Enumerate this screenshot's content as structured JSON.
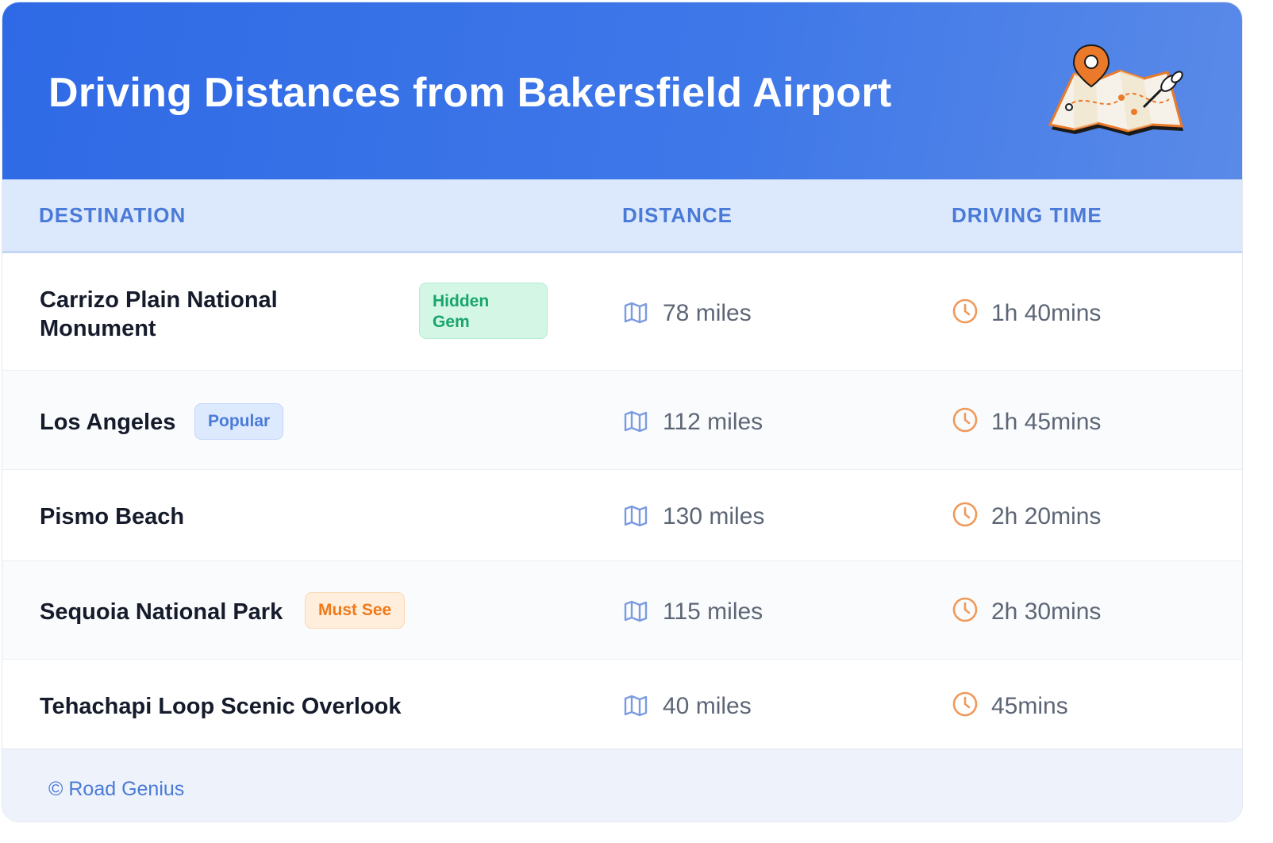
{
  "header": {
    "title": "Driving Distances from Bakersfield Airport"
  },
  "table": {
    "columns": [
      "DESTINATION",
      "DISTANCE",
      "DRIVING TIME"
    ],
    "rows": [
      {
        "destination_line1": "Carrizo Plain National",
        "destination_line2": "Monument",
        "badge_line1": "Hidden",
        "badge_line2": "Gem",
        "distance": "78 miles",
        "time": "1h 40mins"
      },
      {
        "destination": "Los Angeles",
        "badge": "Popular",
        "distance": "112 miles",
        "time": "1h 45mins"
      },
      {
        "destination": "Pismo Beach",
        "distance": "130 miles",
        "time": "2h 20mins"
      },
      {
        "destination": "Sequoia National Park",
        "badge": "Must See",
        "distance": "115 miles",
        "time": "2h 30mins"
      },
      {
        "destination": "Tehachapi Loop Scenic Overlook",
        "distance": "40 miles",
        "time": "45mins"
      }
    ]
  },
  "footer": {
    "copyright": "© Road Genius"
  },
  "icons": {
    "distance": "map-icon",
    "time": "clock-icon",
    "header": "map-illustration"
  },
  "colors": {
    "header_gradient_start": "#2f6ae6",
    "header_gradient_end": "#5a8ae8",
    "accent_blue": "#4a7ad8",
    "badge_green": "#19a56c",
    "badge_orange": "#ee7a1c",
    "time_icon": "#f0995a",
    "distance_icon": "#7a9be0"
  }
}
